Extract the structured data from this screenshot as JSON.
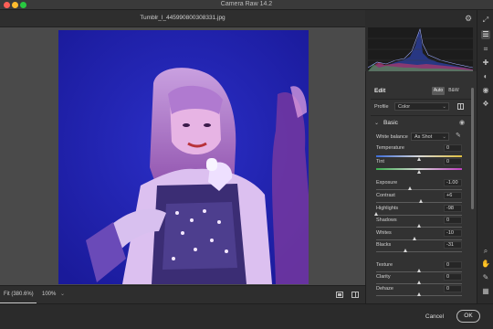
{
  "window": {
    "app_title": "Camera Raw 14.2",
    "filename": "Tumblr_l_445990800308331.jpg"
  },
  "toolbar": {
    "zoom_fit": "Fit (380.6%)",
    "zoom_pct": "100%"
  },
  "edit_panel": {
    "title": "Edit",
    "auto_label": "Auto",
    "bw_label": "B&W",
    "profile_label": "Profile",
    "profile_value": "Color",
    "section_title": "Basic",
    "white_balance_label": "White balance",
    "white_balance_value": "As Shot",
    "sliders": [
      {
        "label": "Temperature",
        "value": "0",
        "level": 0.5
      },
      {
        "label": "Tint",
        "value": "0",
        "level": 0.5
      },
      {
        "label": "Exposure",
        "value": "-1.00",
        "level": 0.4
      },
      {
        "label": "Contrast",
        "value": "+6",
        "level": 0.53
      },
      {
        "label": "Highlights",
        "value": "-98",
        "level": 0.01
      },
      {
        "label": "Shadows",
        "value": "0",
        "level": 0.5
      },
      {
        "label": "Whites",
        "value": "-10",
        "level": 0.45
      },
      {
        "label": "Blacks",
        "value": "-31",
        "level": 0.35
      },
      {
        "label": "Texture",
        "value": "0",
        "level": 0.5
      },
      {
        "label": "Clarity",
        "value": "0",
        "level": 0.5
      },
      {
        "label": "Dehaze",
        "value": "0",
        "level": 0.5
      }
    ]
  },
  "footer": {
    "cancel_label": "Cancel",
    "ok_label": "OK"
  }
}
